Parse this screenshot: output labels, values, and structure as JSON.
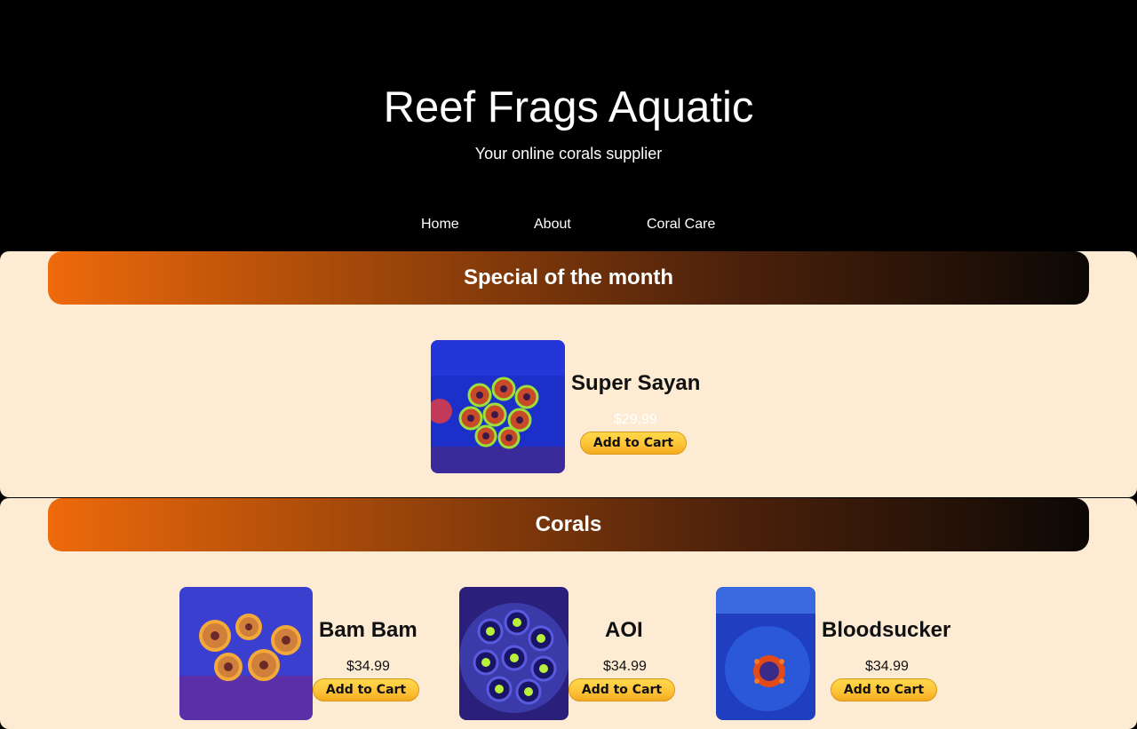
{
  "site": {
    "title": "Reef Frags Aquatic",
    "tagline": "Your online corals supplier"
  },
  "nav": [
    {
      "label": "Home"
    },
    {
      "label": "About"
    },
    {
      "label": "Coral Care"
    }
  ],
  "special": {
    "heading": "Special of the month",
    "product": {
      "name": "Super Sayan",
      "price": "$29.99",
      "button_label": "Add to Cart"
    }
  },
  "corals": {
    "heading": "Corals",
    "products": [
      {
        "name": "Bam Bam",
        "price": "$34.99",
        "button_label": "Add to Cart"
      },
      {
        "name": "AOI",
        "price": "$34.99",
        "button_label": "Add to Cart"
      },
      {
        "name": "Bloodsucker",
        "price": "$34.99",
        "button_label": "Add to Cart"
      }
    ]
  },
  "colors": {
    "page_background": "#000000",
    "section_background": "#fdebd3",
    "header_gradient_start": "#ee6a0b",
    "header_gradient_end": "#0c0805",
    "button_yellow": "#ffc439"
  }
}
